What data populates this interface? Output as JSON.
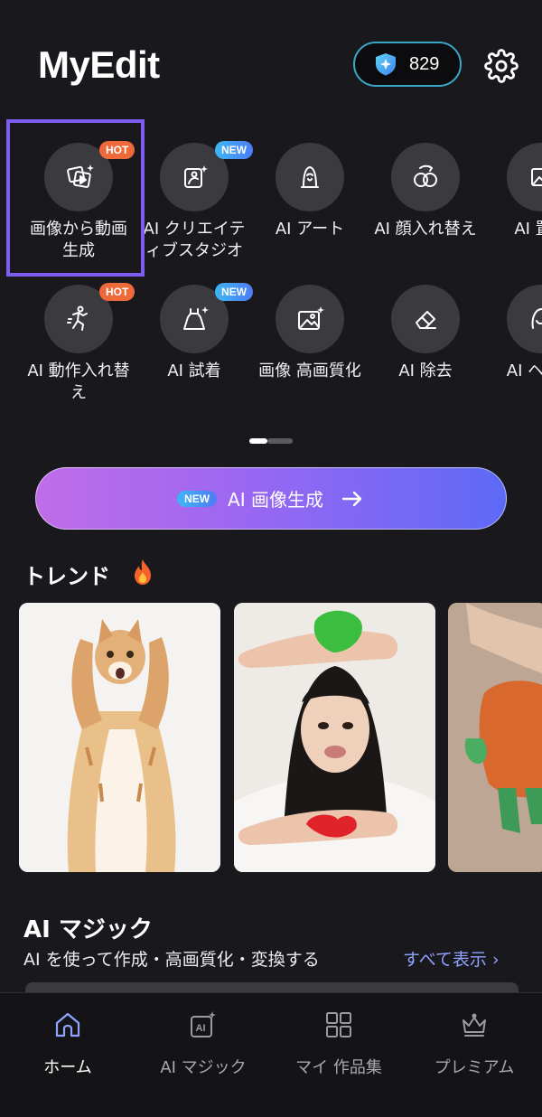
{
  "header": {
    "app_title": "MyEdit",
    "credits": "829",
    "credit_icon": "sparkle-shield-icon",
    "settings_icon": "gear-icon"
  },
  "tools": [
    {
      "label": "画像から動画生成",
      "badge": "HOT",
      "icon": "image-to-video-icon",
      "selected": true
    },
    {
      "label": "AI クリエイティブスタジオ",
      "badge": "NEW",
      "icon": "creative-studio-icon"
    },
    {
      "label": "AI アート",
      "badge": "",
      "icon": "ai-art-portrait-icon"
    },
    {
      "label": "AI 顔入れ替え",
      "badge": "",
      "icon": "face-swap-icon"
    },
    {
      "label": "AI 置き",
      "badge": "",
      "icon": "image-replace-icon"
    },
    {
      "label": "AI 動作入れ替え",
      "badge": "HOT",
      "icon": "motion-swap-icon"
    },
    {
      "label": "AI 試着",
      "badge": "NEW",
      "icon": "dress-try-on-icon"
    },
    {
      "label": "画像 高画質化",
      "badge": "",
      "icon": "image-enhance-icon"
    },
    {
      "label": "AI 除去",
      "badge": "",
      "icon": "eraser-icon"
    },
    {
      "label": "AI ヘアイ",
      "badge": "",
      "icon": "hair-style-icon"
    }
  ],
  "cta": {
    "badge": "NEW",
    "label": "AI 画像生成",
    "gradient": [
      "#c06ce8",
      "#5c6af6"
    ]
  },
  "trend": {
    "title": "トレンド",
    "cards": [
      {
        "subject": "kitten-standing-photo"
      },
      {
        "subject": "girl-with-painted-hands-photo"
      },
      {
        "subject": "orange-figure-photo"
      }
    ]
  },
  "magic": {
    "title": "AI マジック",
    "subtitle": "AI を使って作成・高画質化・変換する",
    "show_all": "すべて表示 ›"
  },
  "tabs": [
    {
      "label": "ホーム",
      "icon": "home-icon",
      "active": true
    },
    {
      "label": "AI マジック",
      "icon": "ai-magic-icon",
      "active": false
    },
    {
      "label": "マイ 作品集",
      "icon": "grid-icon",
      "active": false
    },
    {
      "label": "プレミアム",
      "icon": "crown-icon",
      "active": false
    }
  ],
  "colors": {
    "background": "#19181c",
    "accent": "#7d5cf0",
    "hot_badge": "#ef6a3a",
    "new_badge": "#3db6f5",
    "link": "#8fa3ff",
    "active_tab_icon": "#8fa3ff"
  }
}
